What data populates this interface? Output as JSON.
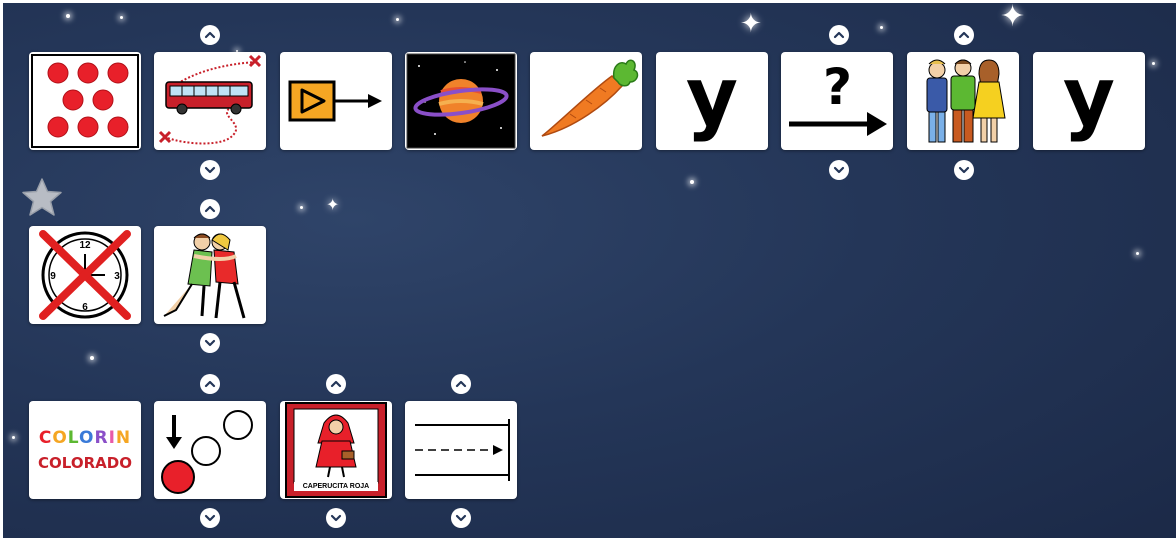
{
  "board": {
    "rows": [
      {
        "cards": [
          {
            "name": "picto-eight-dots"
          },
          {
            "name": "picto-bus-route"
          },
          {
            "name": "picto-play-arrow"
          },
          {
            "name": "picto-planet"
          },
          {
            "name": "picto-carrot"
          },
          {
            "name": "picto-letter-y",
            "text": "y"
          },
          {
            "name": "picto-question-arrow",
            "text": "?"
          },
          {
            "name": "picto-people-group"
          },
          {
            "name": "picto-letter-y",
            "text": "y"
          }
        ]
      },
      {
        "cards": [
          {
            "name": "picto-no-time-clock",
            "clock_numbers": [
              "12",
              "3",
              "6",
              "9"
            ]
          },
          {
            "name": "picto-hug"
          }
        ]
      },
      {
        "cards": [
          {
            "name": "picto-colorin-colorado",
            "top_text": "COLORIN",
            "bottom_text": "COLORADO"
          },
          {
            "name": "picto-circles-down"
          },
          {
            "name": "picto-caperucita-roja",
            "caption": "CAPERUCITA ROJA"
          },
          {
            "name": "picto-lines-end"
          }
        ]
      }
    ]
  },
  "icons": {
    "favorite": "star-icon",
    "up": "chevron-up-icon",
    "down": "chevron-down-icon"
  },
  "colors": {
    "background": "#243658",
    "card": "#ffffff",
    "favorite_star": "#b8bcc4",
    "red": "#e8202a",
    "orange": "#f5a623"
  }
}
